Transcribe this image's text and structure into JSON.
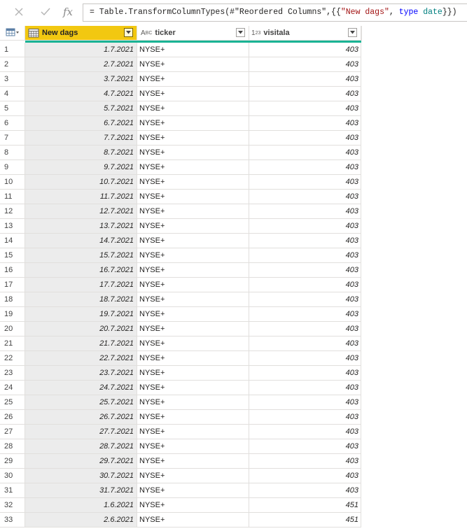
{
  "formula_bar": {
    "cancel_icon": "close-icon",
    "commit_icon": "check-icon",
    "fx_label": "fx",
    "formula_parts": {
      "prefix": "= Table.TransformColumnTypes(#\"Reordered Columns\",{{",
      "str": "\"New dags\"",
      "comma": ", ",
      "kw": "type",
      "space": " ",
      "type": "date",
      "suffix": "}})"
    }
  },
  "columns": [
    {
      "name": "New dags",
      "type_icon": "calendar-icon",
      "selected": true
    },
    {
      "name": "ticker",
      "type_icon": "abc-text-icon",
      "type_glyph": "ABC",
      "selected": false
    },
    {
      "name": "visitala",
      "type_icon": "number-123-icon",
      "type_glyph": "123",
      "selected": false
    }
  ],
  "colors": {
    "selected_header": "#f2c811",
    "quality_bar": "#1ab394",
    "selected_column_bg": "#ececec"
  },
  "rows": [
    {
      "n": "1",
      "date": "1.7.2021",
      "ticker": "NYSE+",
      "visitala": "403"
    },
    {
      "n": "2",
      "date": "2.7.2021",
      "ticker": "NYSE+",
      "visitala": "403"
    },
    {
      "n": "3",
      "date": "3.7.2021",
      "ticker": "NYSE+",
      "visitala": "403"
    },
    {
      "n": "4",
      "date": "4.7.2021",
      "ticker": "NYSE+",
      "visitala": "403"
    },
    {
      "n": "5",
      "date": "5.7.2021",
      "ticker": "NYSE+",
      "visitala": "403"
    },
    {
      "n": "6",
      "date": "6.7.2021",
      "ticker": "NYSE+",
      "visitala": "403"
    },
    {
      "n": "7",
      "date": "7.7.2021",
      "ticker": "NYSE+",
      "visitala": "403"
    },
    {
      "n": "8",
      "date": "8.7.2021",
      "ticker": "NYSE+",
      "visitala": "403"
    },
    {
      "n": "9",
      "date": "9.7.2021",
      "ticker": "NYSE+",
      "visitala": "403"
    },
    {
      "n": "10",
      "date": "10.7.2021",
      "ticker": "NYSE+",
      "visitala": "403"
    },
    {
      "n": "11",
      "date": "11.7.2021",
      "ticker": "NYSE+",
      "visitala": "403"
    },
    {
      "n": "12",
      "date": "12.7.2021",
      "ticker": "NYSE+",
      "visitala": "403"
    },
    {
      "n": "13",
      "date": "13.7.2021",
      "ticker": "NYSE+",
      "visitala": "403"
    },
    {
      "n": "14",
      "date": "14.7.2021",
      "ticker": "NYSE+",
      "visitala": "403"
    },
    {
      "n": "15",
      "date": "15.7.2021",
      "ticker": "NYSE+",
      "visitala": "403"
    },
    {
      "n": "16",
      "date": "16.7.2021",
      "ticker": "NYSE+",
      "visitala": "403"
    },
    {
      "n": "17",
      "date": "17.7.2021",
      "ticker": "NYSE+",
      "visitala": "403"
    },
    {
      "n": "18",
      "date": "18.7.2021",
      "ticker": "NYSE+",
      "visitala": "403"
    },
    {
      "n": "19",
      "date": "19.7.2021",
      "ticker": "NYSE+",
      "visitala": "403"
    },
    {
      "n": "20",
      "date": "20.7.2021",
      "ticker": "NYSE+",
      "visitala": "403"
    },
    {
      "n": "21",
      "date": "21.7.2021",
      "ticker": "NYSE+",
      "visitala": "403"
    },
    {
      "n": "22",
      "date": "22.7.2021",
      "ticker": "NYSE+",
      "visitala": "403"
    },
    {
      "n": "23",
      "date": "23.7.2021",
      "ticker": "NYSE+",
      "visitala": "403"
    },
    {
      "n": "24",
      "date": "24.7.2021",
      "ticker": "NYSE+",
      "visitala": "403"
    },
    {
      "n": "25",
      "date": "25.7.2021",
      "ticker": "NYSE+",
      "visitala": "403"
    },
    {
      "n": "26",
      "date": "26.7.2021",
      "ticker": "NYSE+",
      "visitala": "403"
    },
    {
      "n": "27",
      "date": "27.7.2021",
      "ticker": "NYSE+",
      "visitala": "403"
    },
    {
      "n": "28",
      "date": "28.7.2021",
      "ticker": "NYSE+",
      "visitala": "403"
    },
    {
      "n": "29",
      "date": "29.7.2021",
      "ticker": "NYSE+",
      "visitala": "403"
    },
    {
      "n": "30",
      "date": "30.7.2021",
      "ticker": "NYSE+",
      "visitala": "403"
    },
    {
      "n": "31",
      "date": "31.7.2021",
      "ticker": "NYSE+",
      "visitala": "403"
    },
    {
      "n": "32",
      "date": "1.6.2021",
      "ticker": "NYSE+",
      "visitala": "451"
    },
    {
      "n": "33",
      "date": "2.6.2021",
      "ticker": "NYSE+",
      "visitala": "451"
    }
  ]
}
